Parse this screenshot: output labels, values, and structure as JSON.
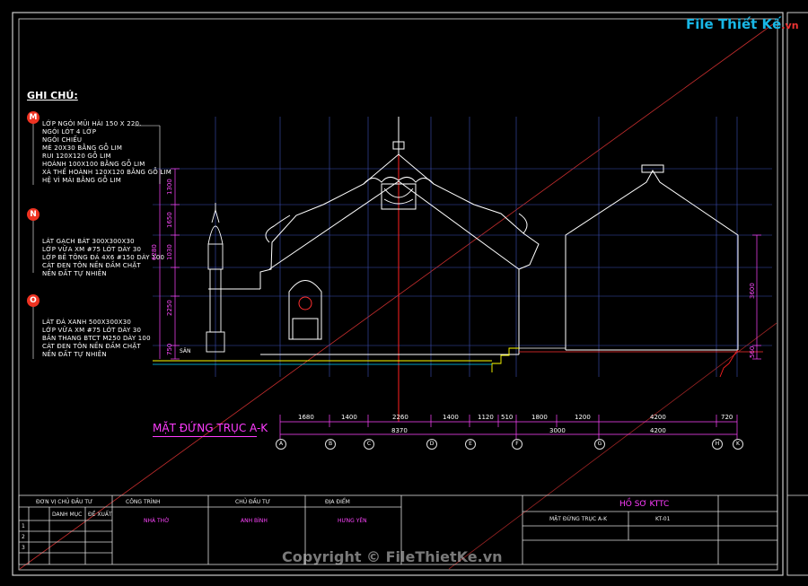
{
  "logo": {
    "text": "File Thiết Kế",
    "suffix": ".vn"
  },
  "watermark": "Copyright © FileThietKe.vn",
  "notes": {
    "header": "GHI CHÚ:",
    "group_m": {
      "marker": "M",
      "items": [
        "LỚP NGÓI MŨI HÀI 150 X 220.",
        "NGÓI LÓT 4 LỚP",
        "NGÓI CHIẾU",
        "MÈ 20X30 BẰNG GỖ LIM",
        "RUI 120X120 GỖ LIM",
        "HOÀNH 100X100 BẰNG GỖ LIM",
        "XÀ THẾ HOÀNH 120X120 BẰNG GỖ LIM",
        "HỆ VÌ MÁI BẰNG GỖ LIM"
      ]
    },
    "group_n": {
      "marker": "N",
      "items": [
        "LÁT GẠCH BÁT 300X300X30",
        "LỚP VỮA XM #75 LÓT DÀY 30",
        "LỚP BÊ TÔNG ĐÁ 4X6 #150 DÀY 100",
        "CÁT ĐEN TÔN NỀN ĐẦM CHẶT",
        "NỀN ĐẤT TỰ NHIÊN"
      ]
    },
    "group_o": {
      "marker": "O",
      "items": [
        "LÁT ĐÁ XANH 500X300X30",
        "LỚP VỮA XM #75 LÓT DÀY 30",
        "BẢN THANG BTCT M250 DÀY 100",
        "CÁT ĐEN TÔN NỀN ĐẦM CHẶT",
        "NỀN ĐẤT TỰ NHIÊN"
      ]
    }
  },
  "drawing": {
    "title": "MẶT ĐỨNG TRỤC A-K",
    "ground_label": "SÂN",
    "dims_top": [
      "1680",
      "1400",
      "2260",
      "1400",
      "1120",
      "510",
      "1800",
      "1200",
      "4200",
      "720"
    ],
    "dims_sub": [
      "3000",
      "4200"
    ],
    "dims_total": "8370",
    "axes": [
      "A",
      "B",
      "C",
      "D",
      "E",
      "F",
      "G",
      "H",
      "K"
    ],
    "vdims_left": [
      "1300",
      "1650",
      "1030",
      "2250",
      "750"
    ],
    "vdims_left_total": "6280",
    "vdims_right": [
      "3600",
      "560"
    ]
  },
  "title_block": {
    "col1": {
      "head": "ĐƠN VỊ CHỦ ĐẦU TƯ",
      "sub": [
        "DANH MỤC",
        "ĐỀ XUẤT"
      ],
      "rows": [
        "1",
        "2",
        "3"
      ]
    },
    "col2": {
      "head": "CÔNG TRÌNH",
      "value": "NHÀ THỜ"
    },
    "col3": {
      "head": "CHỦ ĐẦU TƯ",
      "value": "ANH BÌNH"
    },
    "col4": {
      "head": "ĐỊA ĐIỂM",
      "value": "HƯNG YÊN"
    },
    "project": "HỒ SƠ KTTC",
    "sheet_name": "MẶT ĐỨNG TRỤC A-K",
    "sheet_code": "KT-01"
  },
  "colors": {
    "magenta": "#ff3cff",
    "cyan": "#00c8ff",
    "red": "#ff2020",
    "yellow": "#ffff00",
    "line": "#ffffff",
    "grid": "#5a6ad8"
  }
}
